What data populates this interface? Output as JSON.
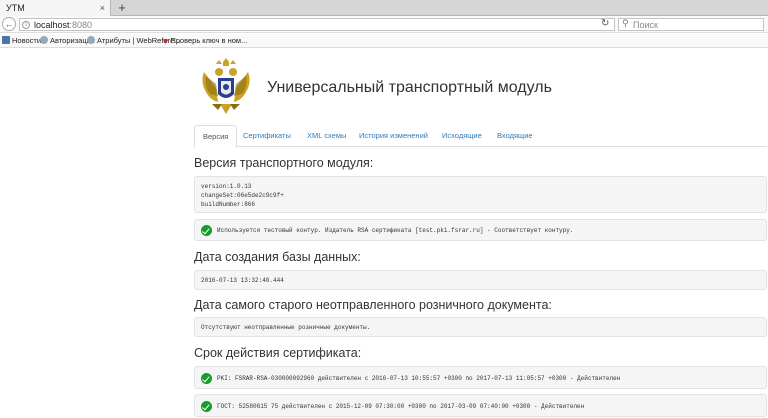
{
  "browser": {
    "tab_title": "УТМ",
    "tab_close": "×",
    "new_tab": "+",
    "url_host": "localhost",
    "url_port": ":8080",
    "search_placeholder": "Поиск",
    "bookmarks": [
      "Новости",
      "Авторизация",
      "Атрибуты | WebRefere...",
      "Проверь ключ в ном..."
    ]
  },
  "page": {
    "title": "Универсальный транспортный модуль",
    "tabs": [
      {
        "label": "Версия",
        "active": true
      },
      {
        "label": "Сертификаты",
        "active": false
      },
      {
        "label": "XML схемы",
        "active": false
      },
      {
        "label": "История изменений",
        "active": false
      },
      {
        "label": "Исходящие",
        "active": false
      },
      {
        "label": "Входящие",
        "active": false
      }
    ],
    "version_section": {
      "title": "Версия транспортного модуля:",
      "lines": [
        "version:1.0.13",
        "changeSet:06e5de2c9c9f+",
        "buildNumber:866"
      ],
      "contour_status": "Используется тестовый контур. Издатель RSA сертификата [test.pki.fsrar.ru] - Соответствует контуру."
    },
    "db_section": {
      "title": "Дата создания базы данных:",
      "value": "2016-07-13 13:32:40.444"
    },
    "retail_section": {
      "title": "Дата самого старого неотправленного розничного документа:",
      "value": "Отсутствуют неотправленные розничные документы."
    },
    "cert_section": {
      "title": "Срок действия сертификата:",
      "items": [
        "PKI: FSRAR-RSA-030000092960 действителен с 2016-07-13 10:55:57 +0300 по 2017-07-13 11:05:57 +0300 - Действителен",
        "ГОСТ: 52580615 75 действителен с 2015-12-09 07:30:00 +0300 по 2017-03-09 07:40:00 +0300 - Действителен"
      ]
    }
  },
  "colors": {
    "link": "#337ab7",
    "success": "#1a9a2a",
    "well_bg": "#f5f5f5"
  }
}
